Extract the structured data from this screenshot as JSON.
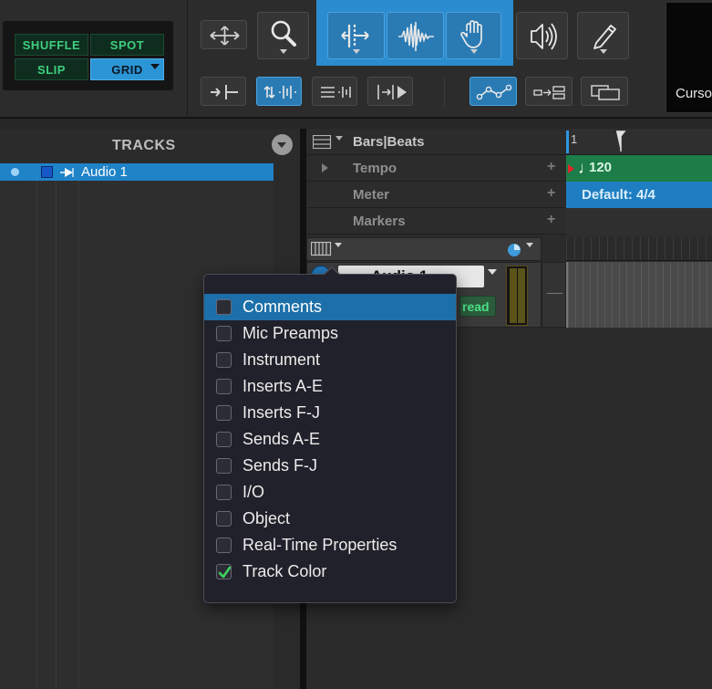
{
  "modes": {
    "shuffle": "SHUFFLE",
    "spot": "SPOT",
    "slip": "SLIP",
    "grid": "GRID"
  },
  "cursor_panel": {
    "label": "Curso"
  },
  "tracks": {
    "title": "TRACKS",
    "items": [
      {
        "name": "Audio 1"
      }
    ]
  },
  "rulers": {
    "bars_beats": "Bars|Beats",
    "tempo": "Tempo",
    "meter": "Meter",
    "markers": "Markers",
    "bar_number": "1",
    "tempo_value": "120",
    "meter_value": "Default: 4/4"
  },
  "edit_track": {
    "name": "Audio 1",
    "automation": "read"
  },
  "menu": {
    "items": [
      {
        "label": "Comments",
        "checked": false,
        "highlighted": true
      },
      {
        "label": "Mic Preamps",
        "checked": false
      },
      {
        "label": "Instrument",
        "checked": false
      },
      {
        "label": "Inserts A-E",
        "checked": false
      },
      {
        "label": "Inserts F-J",
        "checked": false
      },
      {
        "label": "Sends A-E",
        "checked": false
      },
      {
        "label": "Sends F-J",
        "checked": false
      },
      {
        "label": "I/O",
        "checked": false
      },
      {
        "label": "Object",
        "checked": false
      },
      {
        "label": "Real-Time Properties",
        "checked": false
      },
      {
        "label": "Track Color",
        "checked": true
      }
    ]
  },
  "colors": {
    "accent_blue": "#2b95d6",
    "mode_green": "#3fcf7e",
    "check_green": "#3bd45f",
    "tempo_green": "#1c7d48",
    "meter_blue": "#1f7ec1"
  }
}
